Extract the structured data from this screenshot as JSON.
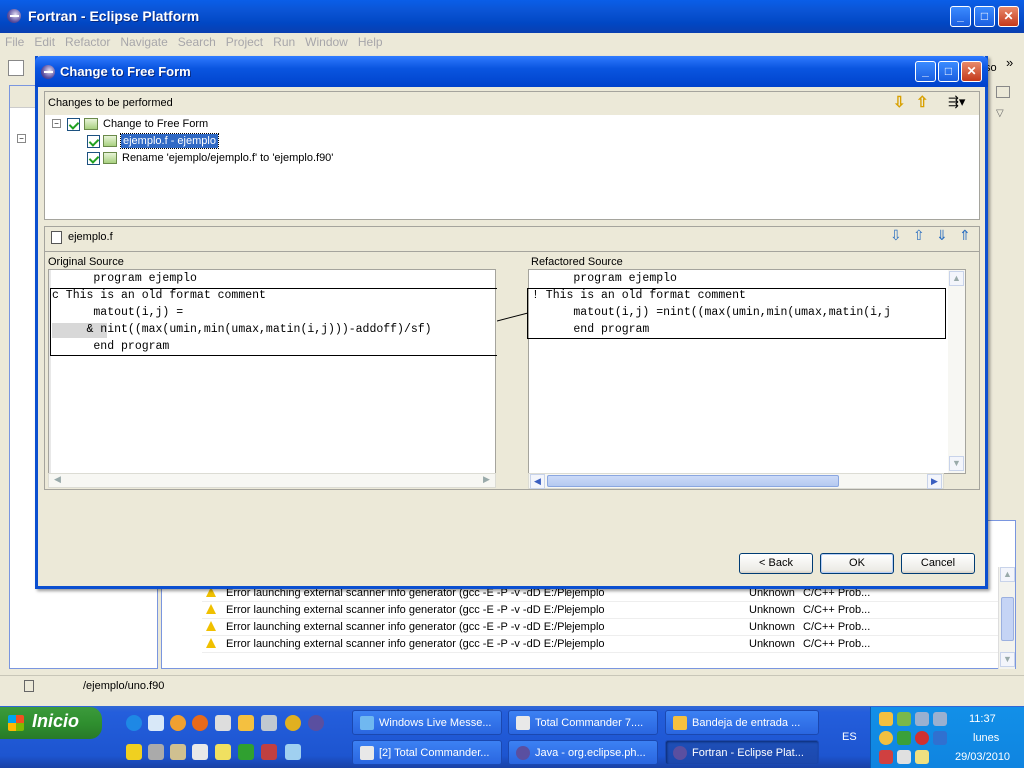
{
  "main_window": {
    "title": "Fortran - Eclipse Platform",
    "controls": {
      "minimize": "_",
      "maximize": "□",
      "close": "✕"
    }
  },
  "menu": [
    "File",
    "Edit",
    "Refactor",
    "Navigate",
    "Search",
    "Project",
    "Run",
    "Window",
    "Help"
  ],
  "toolbar_overflow": "so",
  "toolbar_chevron": "»",
  "dialog": {
    "title": "Change to Free Form",
    "changes_label": "Changes to be performed",
    "tree": {
      "root": "Change to Free Form",
      "children": [
        "ejemplo.f - ejemplo",
        "Rename 'ejemplo/ejemplo.f' to 'ejemplo.f90'"
      ]
    },
    "file_label": "ejemplo.f",
    "original_label": "Original Source",
    "refactored_label": "Refactored Source",
    "original_lines": [
      "      program ejemplo",
      "c This is an old format comment",
      "      matout(i,j) =",
      "     & nint((max(umin,min(umax,matin(i,j)))-addoff)/sf)",
      "      end program"
    ],
    "refactored_lines": [
      "      program ejemplo",
      "! This is an old format comment",
      "      matout(i,j) =nint((max(umin,min(umax,matin(i,j",
      "      end program"
    ],
    "buttons": {
      "back": "< Back",
      "ok": "OK",
      "cancel": "Cancel"
    }
  },
  "problems": [
    {
      "description": "Error launching external scanner info generator (gcc -E -P -v -dD E:/Pl",
      "resource": "ejemplo",
      "location": "Unknown",
      "type": "C/C++ Prob..."
    },
    {
      "description": "Error launching external scanner info generator (gcc -E -P -v -dD E:/Pl",
      "resource": "ejemplo",
      "location": "Unknown",
      "type": "C/C++ Prob..."
    },
    {
      "description": "Error launching external scanner info generator (gcc -E -P -v -dD E:/Pl",
      "resource": "ejemplo",
      "location": "Unknown",
      "type": "C/C++ Prob..."
    },
    {
      "description": "Error launching external scanner info generator (gcc -E -P -v -dD E:/Pl",
      "resource": "ejemplo",
      "location": "Unknown",
      "type": "C/C++ Prob..."
    }
  ],
  "status_path": "/ejemplo/uno.f90",
  "taskbar": {
    "start": "Inicio",
    "tasks_row1": [
      "Windows Live Messe...",
      "Total Commander 7....",
      "Bandeja de entrada ..."
    ],
    "tasks_row2": [
      "[2] Total Commander...",
      "Java - org.eclipse.ph...",
      "Fortran - Eclipse Plat..."
    ],
    "language": "ES",
    "clock_time": "11:37",
    "clock_day": "lunes",
    "clock_date": "29/03/2010"
  }
}
